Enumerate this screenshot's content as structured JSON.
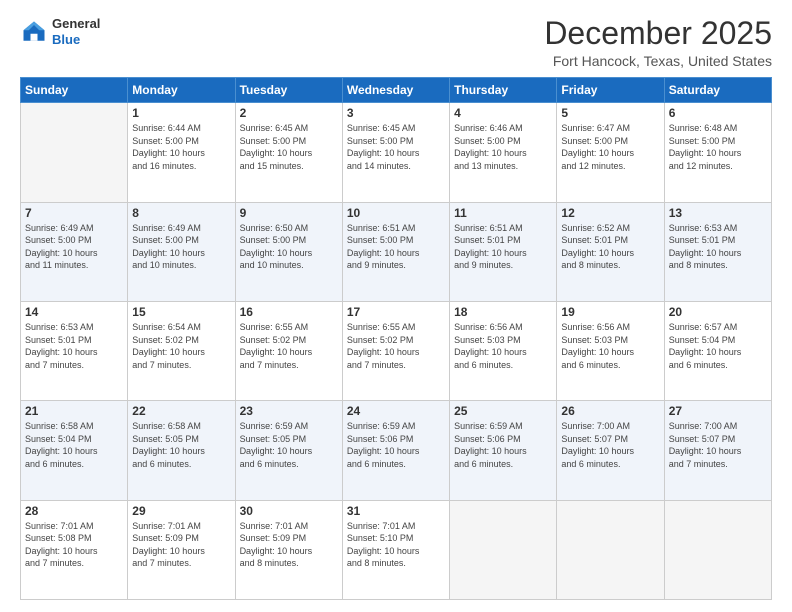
{
  "header": {
    "logo_line1": "General",
    "logo_line2": "Blue",
    "title": "December 2025",
    "location": "Fort Hancock, Texas, United States"
  },
  "days_of_week": [
    "Sunday",
    "Monday",
    "Tuesday",
    "Wednesday",
    "Thursday",
    "Friday",
    "Saturday"
  ],
  "weeks": [
    [
      {
        "day": "",
        "info": ""
      },
      {
        "day": "1",
        "info": "Sunrise: 6:44 AM\nSunset: 5:00 PM\nDaylight: 10 hours\nand 16 minutes."
      },
      {
        "day": "2",
        "info": "Sunrise: 6:45 AM\nSunset: 5:00 PM\nDaylight: 10 hours\nand 15 minutes."
      },
      {
        "day": "3",
        "info": "Sunrise: 6:45 AM\nSunset: 5:00 PM\nDaylight: 10 hours\nand 14 minutes."
      },
      {
        "day": "4",
        "info": "Sunrise: 6:46 AM\nSunset: 5:00 PM\nDaylight: 10 hours\nand 13 minutes."
      },
      {
        "day": "5",
        "info": "Sunrise: 6:47 AM\nSunset: 5:00 PM\nDaylight: 10 hours\nand 12 minutes."
      },
      {
        "day": "6",
        "info": "Sunrise: 6:48 AM\nSunset: 5:00 PM\nDaylight: 10 hours\nand 12 minutes."
      }
    ],
    [
      {
        "day": "7",
        "info": "Sunrise: 6:49 AM\nSunset: 5:00 PM\nDaylight: 10 hours\nand 11 minutes."
      },
      {
        "day": "8",
        "info": "Sunrise: 6:49 AM\nSunset: 5:00 PM\nDaylight: 10 hours\nand 10 minutes."
      },
      {
        "day": "9",
        "info": "Sunrise: 6:50 AM\nSunset: 5:00 PM\nDaylight: 10 hours\nand 10 minutes."
      },
      {
        "day": "10",
        "info": "Sunrise: 6:51 AM\nSunset: 5:00 PM\nDaylight: 10 hours\nand 9 minutes."
      },
      {
        "day": "11",
        "info": "Sunrise: 6:51 AM\nSunset: 5:01 PM\nDaylight: 10 hours\nand 9 minutes."
      },
      {
        "day": "12",
        "info": "Sunrise: 6:52 AM\nSunset: 5:01 PM\nDaylight: 10 hours\nand 8 minutes."
      },
      {
        "day": "13",
        "info": "Sunrise: 6:53 AM\nSunset: 5:01 PM\nDaylight: 10 hours\nand 8 minutes."
      }
    ],
    [
      {
        "day": "14",
        "info": "Sunrise: 6:53 AM\nSunset: 5:01 PM\nDaylight: 10 hours\nand 7 minutes."
      },
      {
        "day": "15",
        "info": "Sunrise: 6:54 AM\nSunset: 5:02 PM\nDaylight: 10 hours\nand 7 minutes."
      },
      {
        "day": "16",
        "info": "Sunrise: 6:55 AM\nSunset: 5:02 PM\nDaylight: 10 hours\nand 7 minutes."
      },
      {
        "day": "17",
        "info": "Sunrise: 6:55 AM\nSunset: 5:02 PM\nDaylight: 10 hours\nand 7 minutes."
      },
      {
        "day": "18",
        "info": "Sunrise: 6:56 AM\nSunset: 5:03 PM\nDaylight: 10 hours\nand 6 minutes."
      },
      {
        "day": "19",
        "info": "Sunrise: 6:56 AM\nSunset: 5:03 PM\nDaylight: 10 hours\nand 6 minutes."
      },
      {
        "day": "20",
        "info": "Sunrise: 6:57 AM\nSunset: 5:04 PM\nDaylight: 10 hours\nand 6 minutes."
      }
    ],
    [
      {
        "day": "21",
        "info": "Sunrise: 6:58 AM\nSunset: 5:04 PM\nDaylight: 10 hours\nand 6 minutes."
      },
      {
        "day": "22",
        "info": "Sunrise: 6:58 AM\nSunset: 5:05 PM\nDaylight: 10 hours\nand 6 minutes."
      },
      {
        "day": "23",
        "info": "Sunrise: 6:59 AM\nSunset: 5:05 PM\nDaylight: 10 hours\nand 6 minutes."
      },
      {
        "day": "24",
        "info": "Sunrise: 6:59 AM\nSunset: 5:06 PM\nDaylight: 10 hours\nand 6 minutes."
      },
      {
        "day": "25",
        "info": "Sunrise: 6:59 AM\nSunset: 5:06 PM\nDaylight: 10 hours\nand 6 minutes."
      },
      {
        "day": "26",
        "info": "Sunrise: 7:00 AM\nSunset: 5:07 PM\nDaylight: 10 hours\nand 6 minutes."
      },
      {
        "day": "27",
        "info": "Sunrise: 7:00 AM\nSunset: 5:07 PM\nDaylight: 10 hours\nand 7 minutes."
      }
    ],
    [
      {
        "day": "28",
        "info": "Sunrise: 7:01 AM\nSunset: 5:08 PM\nDaylight: 10 hours\nand 7 minutes."
      },
      {
        "day": "29",
        "info": "Sunrise: 7:01 AM\nSunset: 5:09 PM\nDaylight: 10 hours\nand 7 minutes."
      },
      {
        "day": "30",
        "info": "Sunrise: 7:01 AM\nSunset: 5:09 PM\nDaylight: 10 hours\nand 8 minutes."
      },
      {
        "day": "31",
        "info": "Sunrise: 7:01 AM\nSunset: 5:10 PM\nDaylight: 10 hours\nand 8 minutes."
      },
      {
        "day": "",
        "info": ""
      },
      {
        "day": "",
        "info": ""
      },
      {
        "day": "",
        "info": ""
      }
    ]
  ]
}
